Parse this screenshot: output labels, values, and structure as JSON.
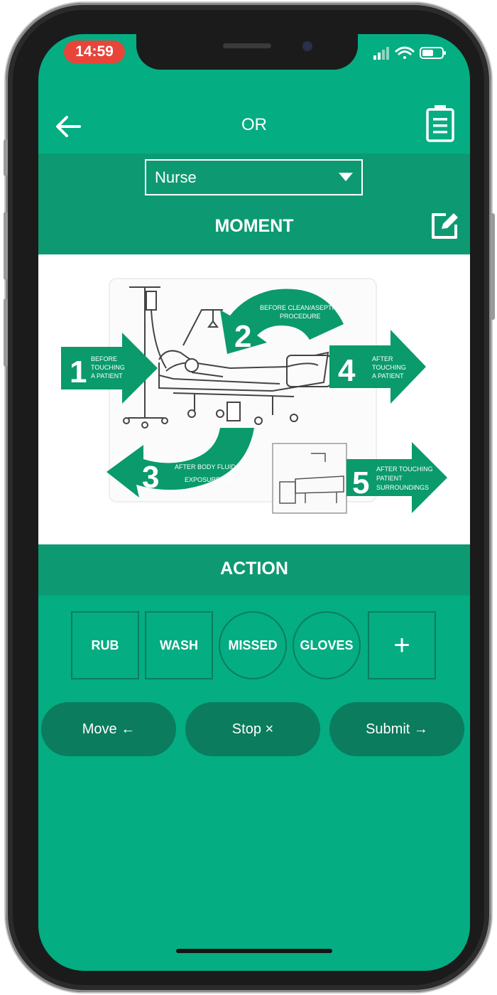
{
  "status_bar": {
    "time": "14:59"
  },
  "header": {
    "title": "OR"
  },
  "role_select": {
    "value": "Nurse"
  },
  "moment": {
    "title": "MOMENT",
    "steps": [
      {
        "number": "1",
        "lines": [
          "BEFORE",
          "TOUCHING",
          "A PATIENT"
        ]
      },
      {
        "number": "2",
        "lines": [
          "BEFORE CLEAN/ASEPTIC",
          "PROCEDURE"
        ]
      },
      {
        "number": "3",
        "lines": [
          "AFTER BODY FLUID",
          "EXPOSURE RISK"
        ]
      },
      {
        "number": "4",
        "lines": [
          "AFTER",
          "TOUCHING",
          "A PATIENT"
        ]
      },
      {
        "number": "5",
        "lines": [
          "AFTER TOUCHING",
          "PATIENT",
          "SURROUNDINGS"
        ]
      }
    ]
  },
  "action": {
    "title": "ACTION",
    "buttons": [
      {
        "label": "RUB",
        "shape": "square"
      },
      {
        "label": "WASH",
        "shape": "square"
      },
      {
        "label": "MISSED",
        "shape": "circle"
      },
      {
        "label": "GLOVES",
        "shape": "circle"
      },
      {
        "label": "+",
        "shape": "square"
      }
    ]
  },
  "controls": {
    "move": "Move ←",
    "stop": "Stop ×",
    "submit": "Submit →"
  },
  "colors": {
    "primary": "#04ad82",
    "band": "#0d9a73",
    "pill": "#0b7c5d",
    "time_pill": "#e8443a"
  }
}
